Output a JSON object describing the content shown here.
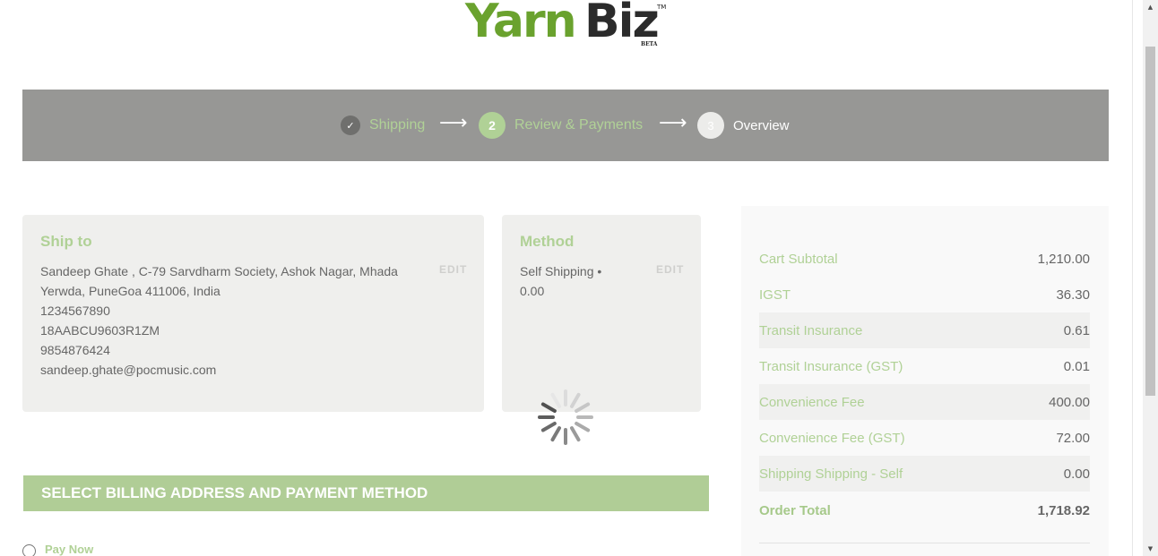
{
  "logo": {
    "part1": "Yarn",
    "part2": "Biz",
    "tm": "TM",
    "beta": "BETA"
  },
  "progress": {
    "steps": [
      {
        "number": "✓",
        "label": "Shipping"
      },
      {
        "number": "2",
        "label": "Review & Payments"
      },
      {
        "number": "3",
        "label": "Overview"
      }
    ],
    "arrow": "⟶"
  },
  "ship_to": {
    "title": "Ship to",
    "edit_label": "EDIT",
    "lines": [
      "Sandeep Ghate , C-79 Sarvdharm Society, Ashok Nagar, Mhada",
      "Yerwda, PuneGoa 411006, India",
      "1234567890",
      "18AABCU9603R1ZM",
      "9854876424",
      "sandeep.ghate@pocmusic.com"
    ]
  },
  "method": {
    "title": "Method",
    "edit_label": "EDIT",
    "line1": "Self Shipping •",
    "line2": "0.00"
  },
  "billing": {
    "title": "SELECT BILLING ADDRESS AND PAYMENT METHOD"
  },
  "payment": {
    "option_label": "Pay Now"
  },
  "summary": {
    "rows": [
      {
        "label": "Cart Subtotal",
        "value": "1,210.00"
      },
      {
        "label": "IGST",
        "value": "36.30"
      },
      {
        "label": "Transit Insurance",
        "value": "0.61"
      },
      {
        "label": "Transit Insurance (GST)",
        "value": "0.01"
      },
      {
        "label": "Convenience Fee",
        "value": "400.00"
      },
      {
        "label": "Convenience Fee (GST)",
        "value": "72.00"
      },
      {
        "label": "Shipping Shipping - Self",
        "value": "0.00"
      },
      {
        "label": "Order Total",
        "value": "1,718.92"
      }
    ]
  },
  "colors": {
    "accent_green": "#b0d196",
    "progress_bg": "#979795",
    "logo_green": "#6aa22e",
    "billing_bg": "#b0cd96"
  },
  "icons": {
    "loading": "loading-spinner-icon",
    "check": "check-icon",
    "scroll_up": "scroll-up-arrow-icon",
    "scroll_down": "scroll-down-arrow-icon"
  }
}
